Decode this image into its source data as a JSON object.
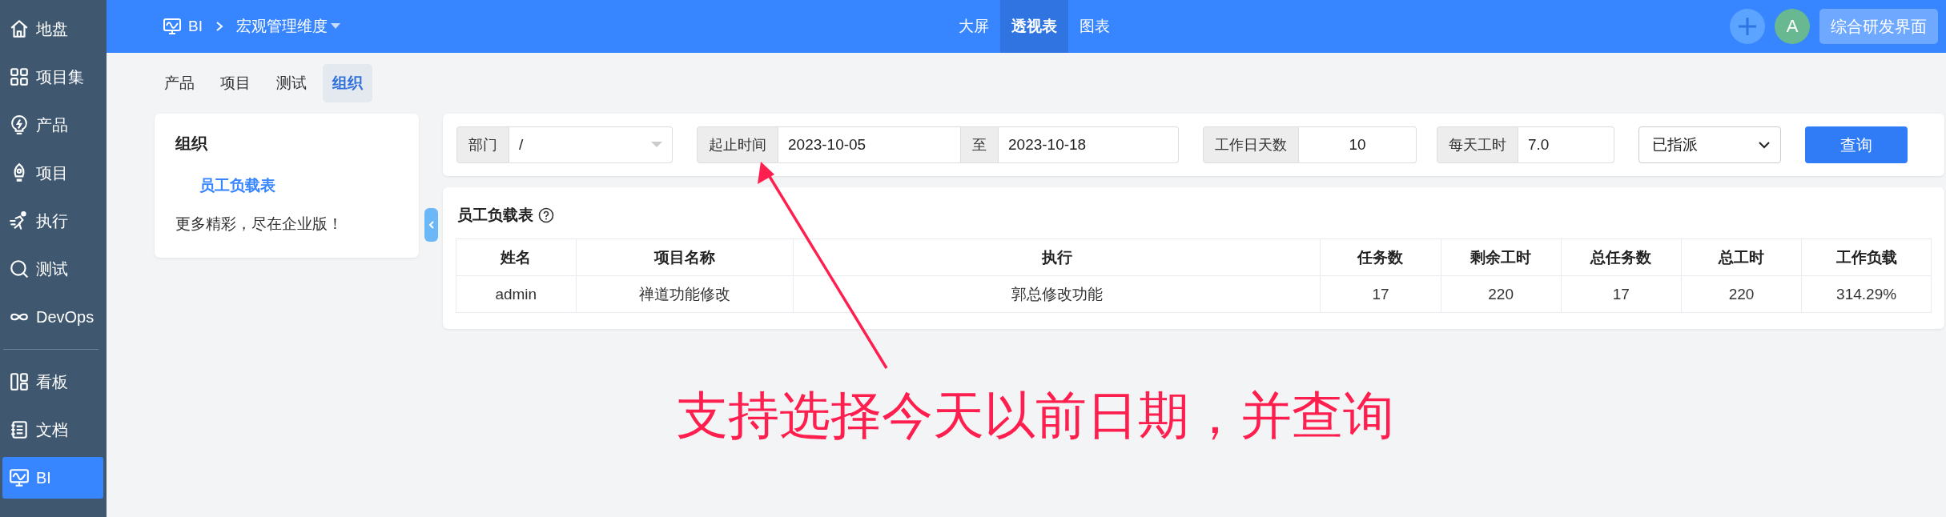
{
  "sidebar": {
    "items": [
      {
        "label": "地盘",
        "selected": false
      },
      {
        "label": "项目集",
        "selected": false
      },
      {
        "label": "产品",
        "selected": false
      },
      {
        "label": "项目",
        "selected": false
      },
      {
        "label": "执行",
        "selected": false
      },
      {
        "label": "测试",
        "selected": false
      },
      {
        "label": "DevOps",
        "selected": false
      },
      {
        "label": "看板",
        "selected": false
      },
      {
        "label": "文档",
        "selected": false
      },
      {
        "label": "BI",
        "selected": true
      }
    ]
  },
  "header": {
    "module": "BI",
    "breadcrumb": "宏观管理维度",
    "tabs": [
      {
        "label": "大屏",
        "selected": false
      },
      {
        "label": "透视表",
        "selected": true
      },
      {
        "label": "图表",
        "selected": false
      }
    ],
    "avatar": "A",
    "switch_button": "综合研发界面"
  },
  "subtabs": [
    {
      "label": "产品",
      "selected": false
    },
    {
      "label": "项目",
      "selected": false
    },
    {
      "label": "测试",
      "selected": false
    },
    {
      "label": "组织",
      "selected": true
    }
  ],
  "side_card": {
    "title": "组织",
    "items": [
      {
        "label": "员工负载表",
        "selected": true
      }
    ],
    "note": "更多精彩，尽在企业版！"
  },
  "filters": {
    "department": {
      "label": "部门",
      "value": "/"
    },
    "date_range": {
      "label": "起止时间",
      "start": "2023-10-05",
      "separator": "至",
      "end": "2023-10-18"
    },
    "workdays": {
      "label": "工作日天数",
      "value": "10"
    },
    "hours": {
      "label": "每天工时",
      "value": "7.0"
    },
    "status": {
      "value": "已指派"
    },
    "query_button": "查询"
  },
  "table": {
    "title": "员工负载表",
    "columns": [
      "姓名",
      "项目名称",
      "执行",
      "任务数",
      "剩余工时",
      "总任务数",
      "总工时",
      "工作负载"
    ],
    "rows": [
      [
        "admin",
        "禅道功能修改",
        "郭总修改功能",
        "17",
        "220",
        "17",
        "220",
        "314.29%"
      ]
    ]
  },
  "annotation": {
    "text": "支持选择今天以前日期，并查询"
  }
}
